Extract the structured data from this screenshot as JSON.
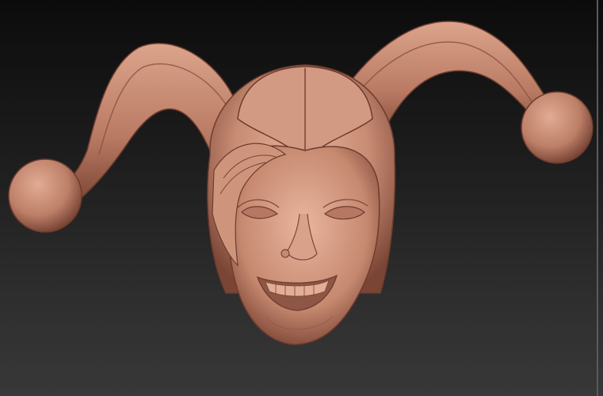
{
  "viewport": {
    "background_top": "#0c0c0c",
    "background_bottom": "#383838"
  },
  "model": {
    "subject": "jester-head-sculpt",
    "material_color": "#c98c74",
    "material_shadow": "#7a4535",
    "material_highlight": "#e8b8a2"
  }
}
